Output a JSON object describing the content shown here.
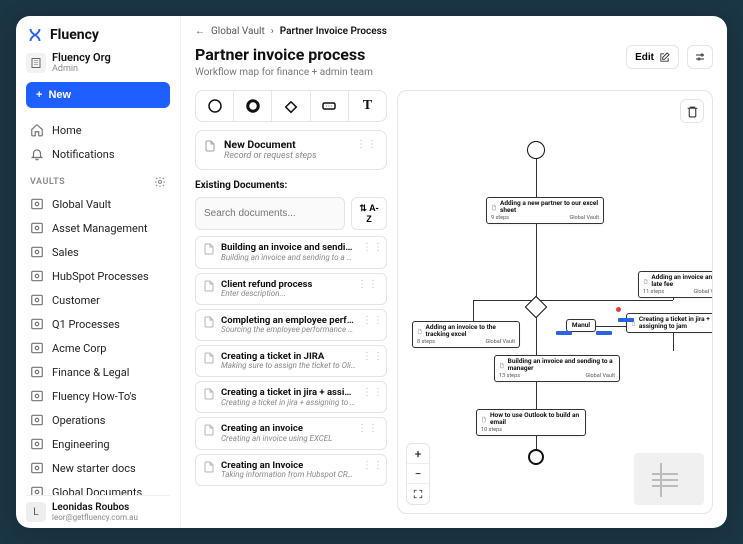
{
  "brand": "Fluency",
  "org": {
    "name": "Fluency Org",
    "role": "Admin"
  },
  "new_btn": "New",
  "nav": {
    "home": "Home",
    "notifications": "Notifications"
  },
  "vaults_head": "VAULTS",
  "vaults": [
    "Global Vault",
    "Asset Management",
    "Sales",
    "HubSpot Processes",
    "Customer",
    "Q1 Processes",
    "Acme Corp",
    "Finance & Legal",
    "Fluency How-To's",
    "Operations",
    "Engineering",
    "New starter docs",
    "Global Documents"
  ],
  "user": {
    "initial": "L",
    "name": "Leonidas Roubos",
    "email": "leor@getfluency.com.au"
  },
  "breadcrumb": {
    "back_icon": "←",
    "parent": "Global Vault",
    "sep": "›",
    "current": "Partner Invoice Process"
  },
  "page": {
    "title": "Partner invoice process",
    "subtitle": "Workflow map for finance + admin team"
  },
  "actions": {
    "edit": "Edit"
  },
  "shapes": {
    "text": "T"
  },
  "new_doc": {
    "title": "New Document",
    "sub": "Record or request steps"
  },
  "existing_head": "Existing Documents:",
  "search": {
    "placeholder": "Search documents..."
  },
  "sort": "⇅ A-Z",
  "docs": [
    {
      "title": "Building an invoice and sending t...",
      "sub": "Building an invoice and sending to a ma..."
    },
    {
      "title": "Client refund process",
      "sub": "Enter description..."
    },
    {
      "title": "Completing an employee perform...",
      "sub": "Sourcing the employee performance sc..."
    },
    {
      "title": "Creating a ticket in JIRA",
      "sub": "Making sure to assign the ticket to Olive..."
    },
    {
      "title": "Creating a ticket in jira + assignin...",
      "sub": "Creating a ticket in jira + assigning to ja..."
    },
    {
      "title": "Creating an invoice",
      "sub": "Creating an invoice using EXCEL"
    },
    {
      "title": "Creating an Invoice",
      "sub": "Taking information from Hubspot CRM, ..."
    }
  ],
  "flow_nodes": {
    "n1": {
      "title": "Adding a new partner to our excel sheet",
      "steps": "9 steps",
      "vault": "Global Vault"
    },
    "n2": {
      "title": "Adding an invoice to the tracking excel",
      "steps": "8 steps",
      "vault": "Global Vault"
    },
    "n3": {
      "title": "Building an invoice and sending to a manager",
      "steps": "13 steps",
      "vault": "Global Vault"
    },
    "n4": {
      "title": "How to use Outlook to build an email",
      "steps": "10 steps",
      "vault": ""
    },
    "n5": {
      "title": "Adding an invoice and a late fee",
      "steps": "11 steps",
      "vault": "Global Vault"
    },
    "n6": {
      "title": "Creating a ticket in jira + assigning to jam",
      "steps": "",
      "vault": ""
    },
    "manual": "Manul"
  }
}
